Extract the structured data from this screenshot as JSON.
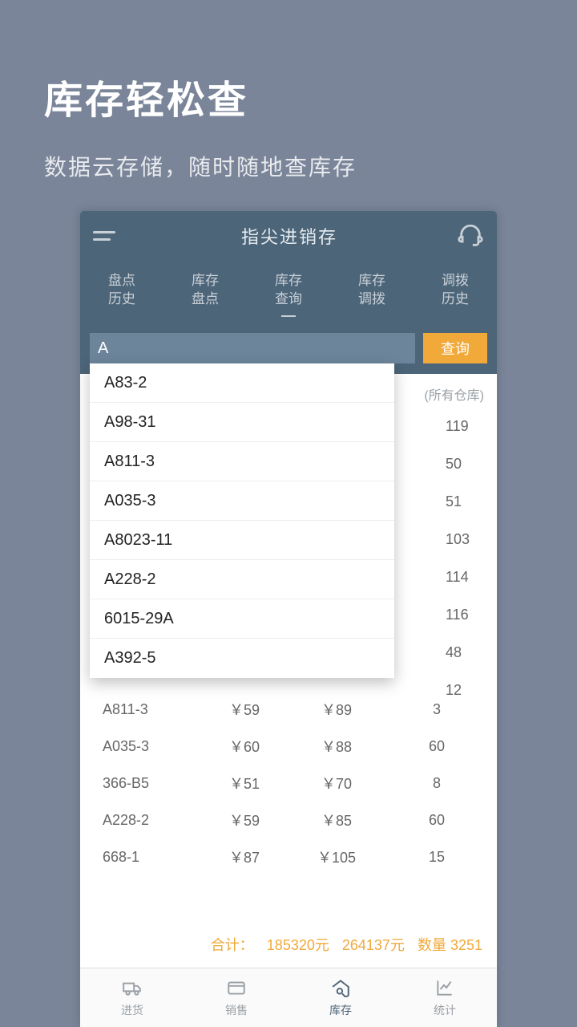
{
  "promo": {
    "title": "库存轻松查",
    "subtitle": "数据云存储，随时随地查库存"
  },
  "header": {
    "app_title": "指尖进销存"
  },
  "tabs": [
    {
      "l1": "盘点",
      "l2": "历史"
    },
    {
      "l1": "库存",
      "l2": "盘点"
    },
    {
      "l1": "库存",
      "l2": "查询"
    },
    {
      "l1": "库存",
      "l2": "调拨"
    },
    {
      "l1": "调拨",
      "l2": "历史"
    }
  ],
  "search": {
    "value": "A",
    "button": "查询"
  },
  "filter_label": "(所有仓库)",
  "dropdown": [
    "A83-2",
    "A98-31",
    "A811-3",
    "A035-3",
    "A8023-11",
    "A228-2",
    "6015-29A",
    "A392-5"
  ],
  "qty_partial": [
    "119",
    "50",
    "51",
    "103",
    "114",
    "116",
    "48",
    "12"
  ],
  "table_rows": [
    {
      "code": "A811-3",
      "p1": "￥59",
      "p2": "￥89",
      "qty": "3"
    },
    {
      "code": "A035-3",
      "p1": "￥60",
      "p2": "￥88",
      "qty": "60"
    },
    {
      "code": "366-B5",
      "p1": "￥51",
      "p2": "￥70",
      "qty": "8"
    },
    {
      "code": "A228-2",
      "p1": "￥59",
      "p2": "￥85",
      "qty": "60"
    },
    {
      "code": "668-1",
      "p1": "￥87",
      "p2": "￥105",
      "qty": "15"
    }
  ],
  "summary": {
    "label": "合计：",
    "v1": "185320元",
    "v2": "264137元",
    "v3": "数量 3251"
  },
  "bottom_nav": [
    {
      "label": "进货"
    },
    {
      "label": "销售"
    },
    {
      "label": "库存"
    },
    {
      "label": "统计"
    }
  ]
}
